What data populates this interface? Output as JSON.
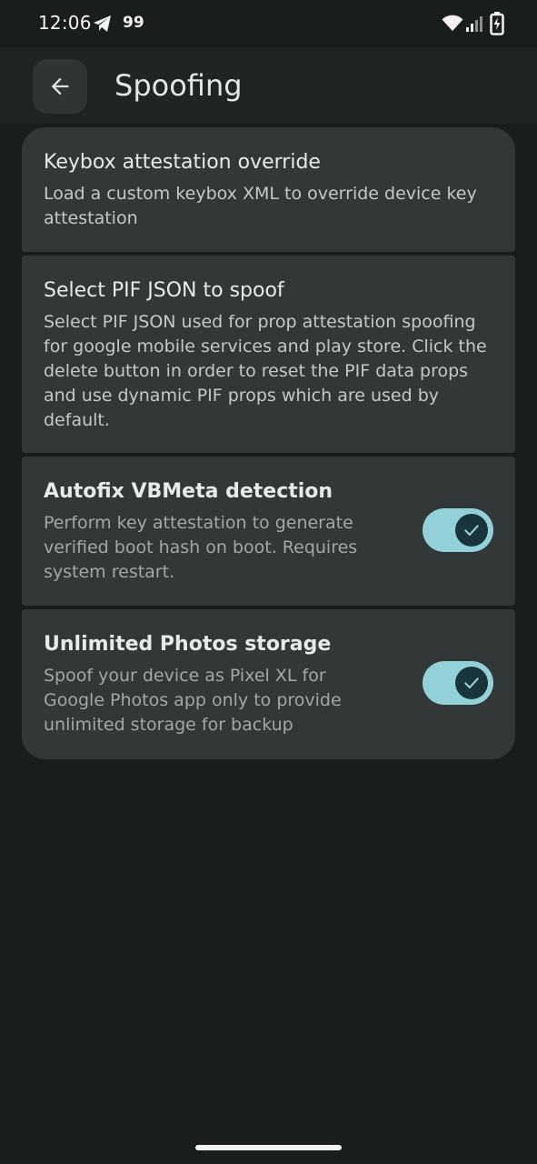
{
  "status_bar": {
    "time": "12:06",
    "notification_count": "99",
    "icons": [
      "telegram-icon",
      "wifi-icon",
      "signal-icon",
      "battery-charging-icon"
    ]
  },
  "app_bar": {
    "title": "Spoofing",
    "back_icon": "arrow-back-icon"
  },
  "settings": [
    {
      "title": "Keybox attestation override",
      "description": "Load a custom keybox XML to override device key attestation",
      "has_toggle": false
    },
    {
      "title": "Select PIF JSON to spoof",
      "description": "Select PIF JSON used for prop attestation spoofing for google mobile services and play store. Click the delete button in order to reset the PIF data props and use dynamic PIF props which are used by default.",
      "has_toggle": false
    },
    {
      "title": "Autofix VBMeta detection",
      "description": "Perform key attestation to generate verified boot hash on boot. Requires system restart.",
      "has_toggle": true,
      "toggle_on": true
    },
    {
      "title": "Unlimited Photos storage",
      "description": "Spoof your device as Pixel XL for Google Photos app only to provide unlimited storage for backup",
      "has_toggle": true,
      "toggle_on": true
    }
  ],
  "colors": {
    "background": "#191d1d",
    "card": "#323838",
    "toggle_track": "#93d1d9",
    "toggle_thumb": "#17353a"
  }
}
